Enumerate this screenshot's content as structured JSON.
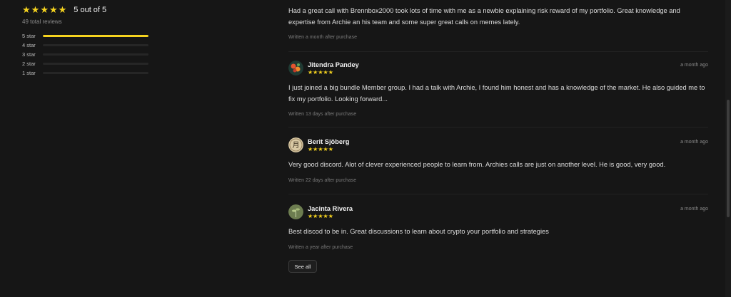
{
  "summary": {
    "rating_text": "5 out of 5",
    "total_reviews": "49 total reviews",
    "distribution": [
      {
        "label": "5 star",
        "fraction": 1.0
      },
      {
        "label": "4 star",
        "fraction": 0.0
      },
      {
        "label": "3 star",
        "fraction": 0.0
      },
      {
        "label": "2 star",
        "fraction": 0.0
      },
      {
        "label": "1 star",
        "fraction": 0.0
      }
    ]
  },
  "colors": {
    "star": "#f5d31f",
    "background": "#161616"
  },
  "reviews": [
    {
      "text": "Had a great call with Brennbox2000 took lots of time with me as a newbie explaining risk reward of my portfolio. Great knowledge and expertise from Archie an his team and some super great calls on memes lately.",
      "meta": "Written a month after purchase"
    },
    {
      "name": "Jitendra Pandey",
      "time": "a month ago",
      "rating": 5,
      "avatar_icon": "flower-avatar",
      "text": "I just joined a big bundle Member group. I had a talk with Archie, I found him honest and has a knowledge of the market. He also guided me to fix my portfolio. Looking forward...",
      "meta": "Written 13 days after purchase"
    },
    {
      "name": "Berit Sjöberg",
      "time": "a month ago",
      "rating": 5,
      "avatar_icon": "moon-glyph-avatar",
      "text": "Very good discord. Alot of clever experienced people to learn from. Archies calls are just on another level. He is good, very good.",
      "meta": "Written 22 days after purchase"
    },
    {
      "name": "Jacinta Rivera",
      "time": "a month ago",
      "rating": 5,
      "avatar_icon": "plant-avatar",
      "text": "Best discod to be in. Great discussions to learn about crypto your portfolio and strategies",
      "meta": "Written a year after purchase"
    }
  ],
  "see_all_label": "See all"
}
